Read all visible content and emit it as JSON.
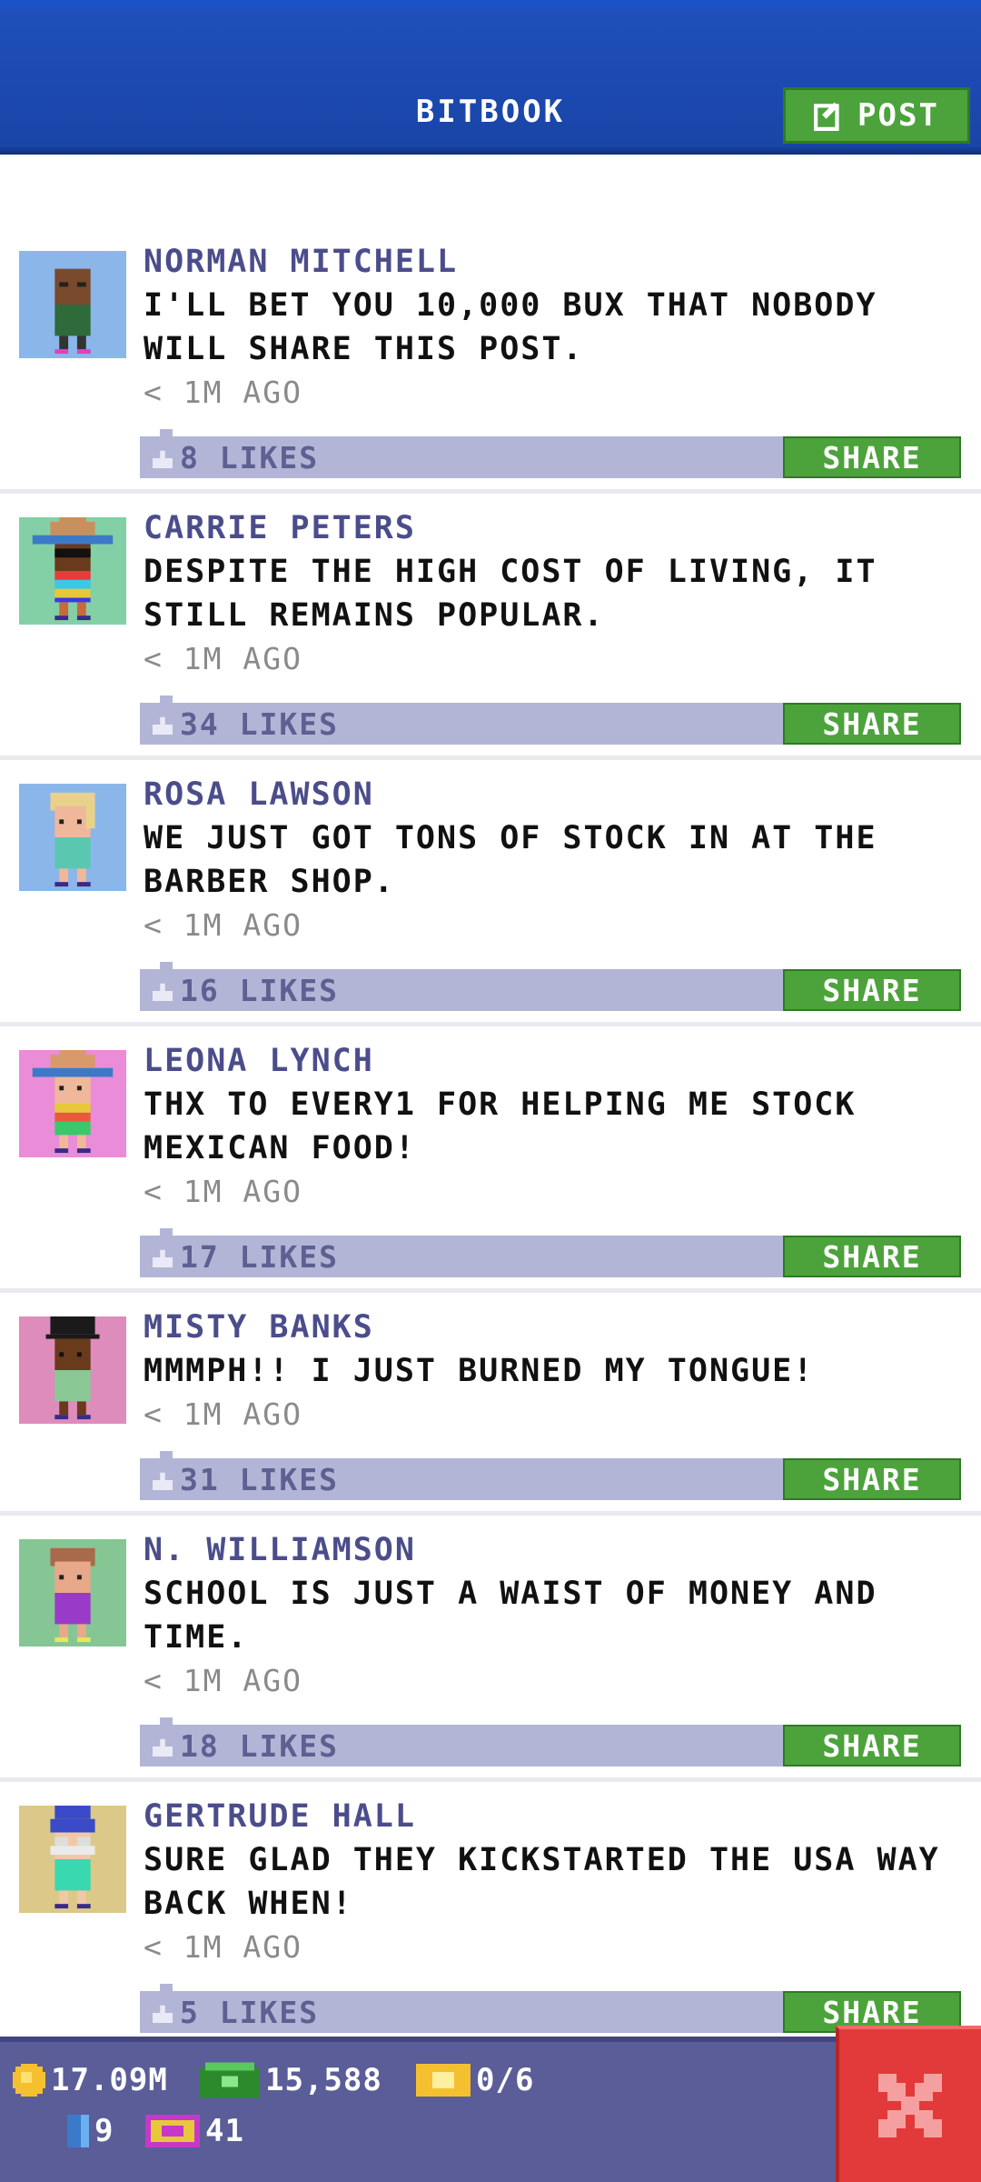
{
  "header": {
    "title": "BITBOOK",
    "post_label": "POST"
  },
  "posts": [
    {
      "name": "NORMAN MITCHELL",
      "message": "I'LL BET YOU 10,000 BUX THAT NOBODY WILL SHARE THIS POST.",
      "time": "< 1M AGO",
      "likes": "8 LIKES",
      "share_label": "SHARE",
      "avatar_bg": "#8ab6ea"
    },
    {
      "name": "CARRIE PETERS",
      "message": "DESPITE THE HIGH COST OF LIVING, IT STILL REMAINS POPULAR.",
      "time": "< 1M AGO",
      "likes": "34 LIKES",
      "share_label": "SHARE",
      "avatar_bg": "#84d0a6"
    },
    {
      "name": "ROSA LAWSON",
      "message": "WE JUST GOT TONS OF STOCK IN AT THE BARBER SHOP.",
      "time": "< 1M AGO",
      "likes": "16 LIKES",
      "share_label": "SHARE",
      "avatar_bg": "#8ab6ea"
    },
    {
      "name": "LEONA LYNCH",
      "message": "THX TO EVERY1 FOR HELPING ME STOCK MEXICAN FOOD!",
      "time": "< 1M AGO",
      "likes": "17 LIKES",
      "share_label": "SHARE",
      "avatar_bg": "#ea8cd8"
    },
    {
      "name": "MISTY BANKS",
      "message": "MMMPH!! I JUST BURNED MY TONGUE!",
      "time": "< 1M AGO",
      "likes": "31 LIKES",
      "share_label": "SHARE",
      "avatar_bg": "#de8cbc"
    },
    {
      "name": "N. WILLIAMSON",
      "message": "SCHOOL IS JUST A WAIST OF MONEY AND TIME.",
      "time": "< 1M AGO",
      "likes": "18 LIKES",
      "share_label": "SHARE",
      "avatar_bg": "#86c694"
    },
    {
      "name": "GERTRUDE HALL",
      "message": "SURE GLAD THEY KICKSTARTED THE USA WAY BACK WHEN!",
      "time": "< 1M AGO",
      "likes": "5 LIKES",
      "share_label": "SHARE",
      "avatar_bg": "#dcc888"
    }
  ],
  "status": {
    "coins": "17.09M",
    "bux": "15,588",
    "tickets": "0/6",
    "bitizens": "9",
    "vip": "41"
  },
  "colors": {
    "accent_green": "#4ca33b",
    "header_blue": "#1a45a8",
    "like_bar": "#b3b5d7",
    "close_red": "#e23a3a"
  },
  "icons": {
    "post": "edit-icon",
    "coin": "coin-icon",
    "bux": "bux-icon",
    "ticket": "ticket-icon",
    "bitizen": "bitizen-icon",
    "vip": "vip-icon",
    "close": "close-icon",
    "like": "thumbs-up-icon"
  }
}
